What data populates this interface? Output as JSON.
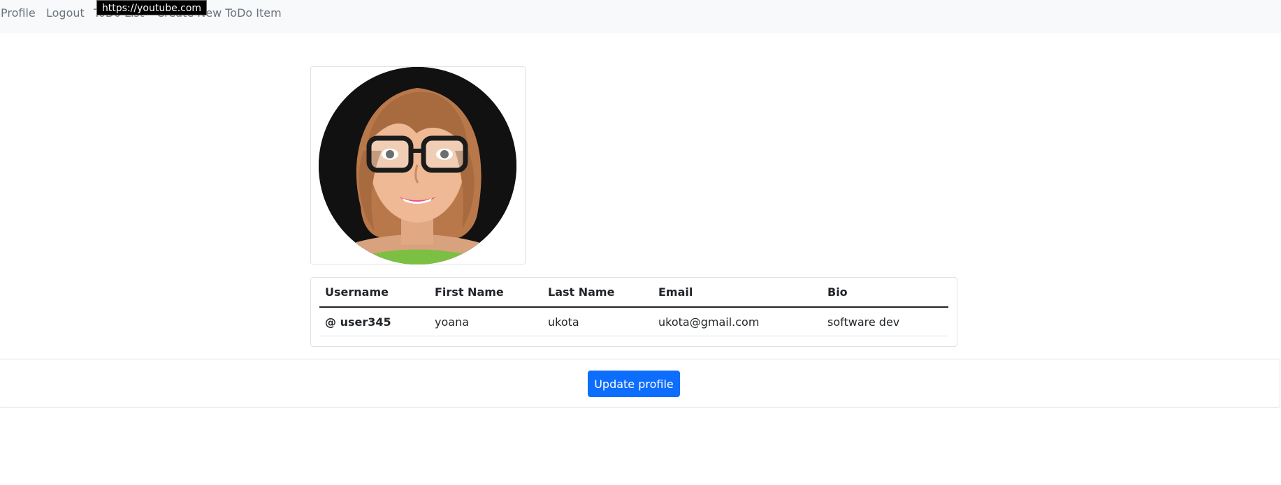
{
  "nav": {
    "links": [
      "Profile",
      "Logout",
      "ToDo List",
      "Create New ToDo Item"
    ]
  },
  "tooltip": {
    "text": "https://youtube.com"
  },
  "profile": {
    "avatar_alt": "profile avatar",
    "table": {
      "headers": [
        "Username",
        "First Name",
        "Last Name",
        "Email",
        "Bio"
      ],
      "row": {
        "username": "@ user345",
        "first_name": "yoana",
        "last_name": "ukota",
        "email": "ukota@gmail.com",
        "bio": "software dev"
      }
    }
  },
  "actions": {
    "update_label": "Update profile"
  },
  "colors": {
    "primary": "#0d6efd",
    "navbar_bg": "#f8f9fa",
    "link": "#6c757d"
  }
}
